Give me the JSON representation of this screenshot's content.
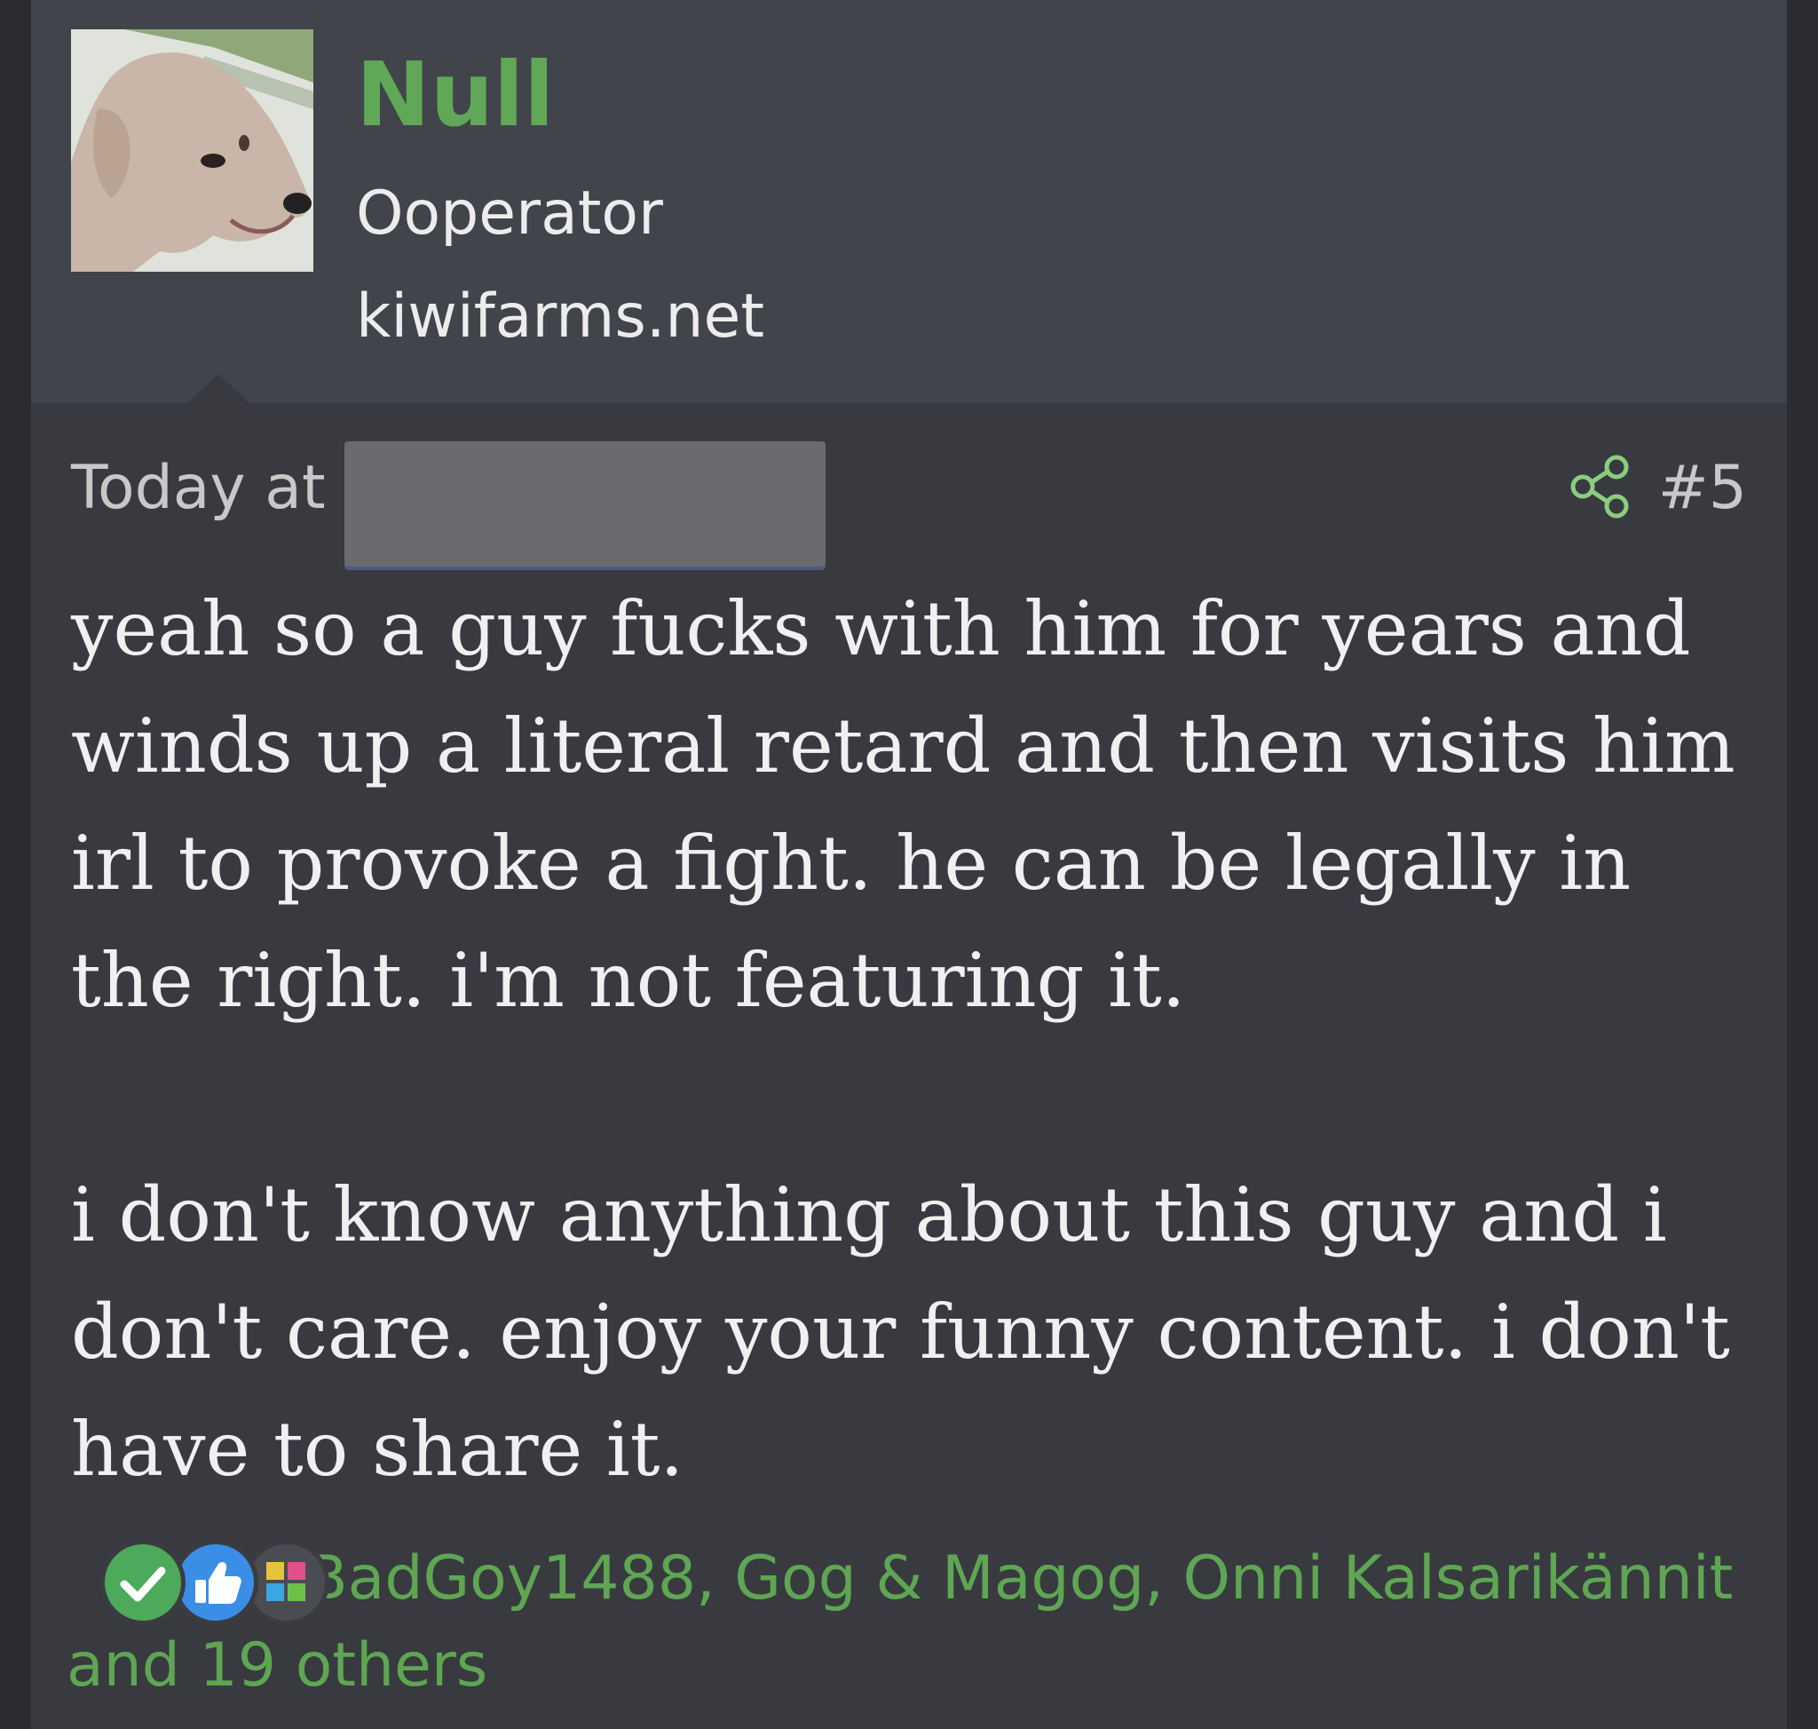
{
  "user": {
    "name": "Null",
    "title": "Ooperator",
    "site": "kiwifarms.net",
    "avatar_icon": "dog-avatar-icon"
  },
  "post": {
    "date_prefix": "Today at",
    "number": "#5",
    "share_icon": "share-icon",
    "paragraphs": [
      "yeah so a guy fucks with him for years and winds up a literal retard and then visits him irl to provoke a fight. he can be legally in the right. i'm not featuring it.",
      "i don't know anything about this guy and i don't care. enjoy your funny content. i don't have to share it."
    ]
  },
  "reactions": {
    "icons": [
      "check-reaction-icon",
      "like-reaction-icon",
      "puzzle-reaction-icon"
    ],
    "users": "BadGoy1488, Gog & Magog, Onni Kalsarikännit",
    "others": "and 19 others"
  },
  "colors": {
    "accent_green": "#60a857",
    "post_bg": "#383a40",
    "user_block_bg": "#41444b"
  }
}
